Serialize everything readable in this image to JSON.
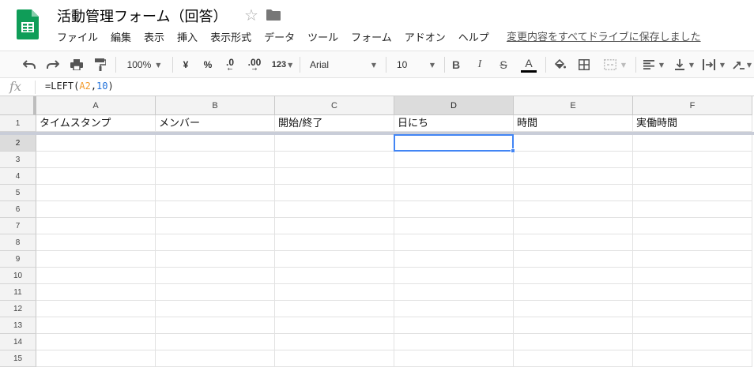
{
  "app": {
    "doc_title": "活動管理フォーム（回答）",
    "save_status": "変更内容をすべてドライブに保存しました",
    "brand_color": "#0f9d58"
  },
  "menu": [
    "ファイル",
    "編集",
    "表示",
    "挿入",
    "表示形式",
    "データ",
    "ツール",
    "フォーム",
    "アドオン",
    "ヘルプ"
  ],
  "toolbar": {
    "zoom": "100%",
    "currency": "¥",
    "percent": "%",
    "decrease_decimals": ".0",
    "increase_decimals": ".00",
    "number_format": "123",
    "font": "Arial",
    "font_size": "10",
    "bold": "B",
    "italic": "I",
    "strike": "S",
    "text_color_letter": "A",
    "icons": [
      "undo-icon",
      "redo-icon",
      "print-icon",
      "paint-format-icon",
      "fill-color-icon",
      "borders-icon",
      "merge-cells-icon",
      "align-left-icon",
      "valign-bottom-icon",
      "text-wrap-icon",
      "text-rotate-icon"
    ]
  },
  "formula_bar": {
    "fx": "fx",
    "prefix": "=LEFT(",
    "ref": "A2",
    "comma": ",",
    "number": "10",
    "suffix": ")"
  },
  "sheet": {
    "columns": [
      "A",
      "B",
      "C",
      "D",
      "E",
      "F"
    ],
    "selected_column": "D",
    "selected_row": 2,
    "row_numbers": [
      "1",
      "2",
      "3",
      "4",
      "5",
      "6",
      "7",
      "8",
      "9",
      "10",
      "11",
      "12",
      "13",
      "14",
      "15"
    ],
    "header_row": [
      "タイムスタンプ",
      "メンバー",
      "開始/終了",
      "日にち",
      "時間",
      "実働時間"
    ]
  }
}
